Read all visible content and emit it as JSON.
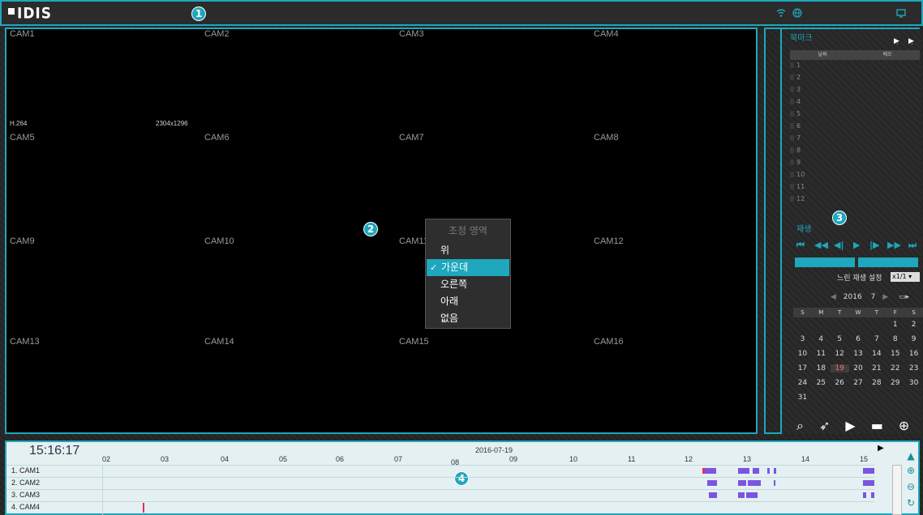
{
  "title_bar": {
    "logo": "IDIS",
    "callout": "1"
  },
  "video": {
    "callout": "2",
    "cams": [
      "CAM1",
      "CAM2",
      "CAM3",
      "CAM4",
      "CAM5",
      "CAM6",
      "CAM7",
      "CAM8",
      "CAM9",
      "CAM10",
      "CAM11",
      "CAM12",
      "CAM13",
      "CAM14",
      "CAM15",
      "CAM16"
    ],
    "codec": "H.264",
    "resolution": "2304x1296"
  },
  "context_menu": {
    "header": "조정 영역",
    "items": [
      {
        "label": "위",
        "selected": false
      },
      {
        "label": "가운데",
        "selected": true
      },
      {
        "label": "오른쪽",
        "selected": false
      },
      {
        "label": "아래",
        "selected": false
      },
      {
        "label": "없음",
        "selected": false
      }
    ],
    "check": "✓"
  },
  "bookmark": {
    "title": "북마크",
    "col_date": "날짜",
    "col_memo": "메모",
    "rows": [
      "1",
      "2",
      "3",
      "4",
      "5",
      "6",
      "7",
      "8",
      "9",
      "10",
      "11",
      "12"
    ]
  },
  "playback": {
    "callout": "3",
    "title": "재생",
    "slow_label": "느린 재생 설정",
    "slow_value": "x1/1",
    "year": "2016",
    "month": "7",
    "dow": [
      "S",
      "M",
      "T",
      "W",
      "T",
      "F",
      "S"
    ],
    "weeks": [
      [
        "",
        "",
        "",
        "",
        "",
        "1",
        "2"
      ],
      [
        "3",
        "4",
        "5",
        "6",
        "7",
        "8",
        "9"
      ],
      [
        "10",
        "11",
        "12",
        "13",
        "14",
        "15",
        "16"
      ],
      [
        "17",
        "18",
        "19",
        "20",
        "21",
        "22",
        "23"
      ],
      [
        "24",
        "25",
        "26",
        "27",
        "28",
        "29",
        "30"
      ],
      [
        "31",
        "",
        "",
        "",
        "",
        "",
        ""
      ]
    ],
    "today": "19"
  },
  "timeline": {
    "callout": "4",
    "clock": "15:16:17",
    "date": "2016-07-19",
    "hours": [
      "02",
      "03",
      "04",
      "05",
      "06",
      "07",
      "08",
      "09",
      "10",
      "11",
      "12",
      "13",
      "14",
      "15"
    ],
    "cameras": [
      "1. CAM1",
      "2. CAM2",
      "3. CAM3",
      "4. CAM4"
    ],
    "colors": {
      "motion": "#7a55e0",
      "alarm": "#e03055",
      "accent": "#1ea7bd"
    }
  }
}
